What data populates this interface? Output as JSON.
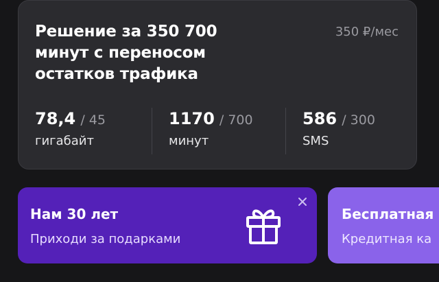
{
  "tariff": {
    "title_lines": [
      "Решение за 350 700",
      "минут с переносом",
      "остатков трафика"
    ],
    "price": "350 ₽/мес",
    "stats": [
      {
        "used": "78,4",
        "limit": "/ 45",
        "unit": "гигабайт"
      },
      {
        "used": "1170",
        "limit": "/ 700",
        "unit": "минут"
      },
      {
        "used": "586",
        "limit": "/ 300",
        "unit": "SMS"
      }
    ]
  },
  "promos": [
    {
      "title": "Нам 30 лет",
      "subtitle": "Приходи за подарками",
      "icon": "gift-icon",
      "close_icon": "close-icon",
      "color": "#5421b8"
    },
    {
      "title": "Бесплатная",
      "subtitle": "Кредитная ка",
      "color": "#8a63ea"
    }
  ],
  "colors": {
    "background": "#161618",
    "card": "#2b2b2f",
    "muted_text": "#9a9aa0"
  }
}
